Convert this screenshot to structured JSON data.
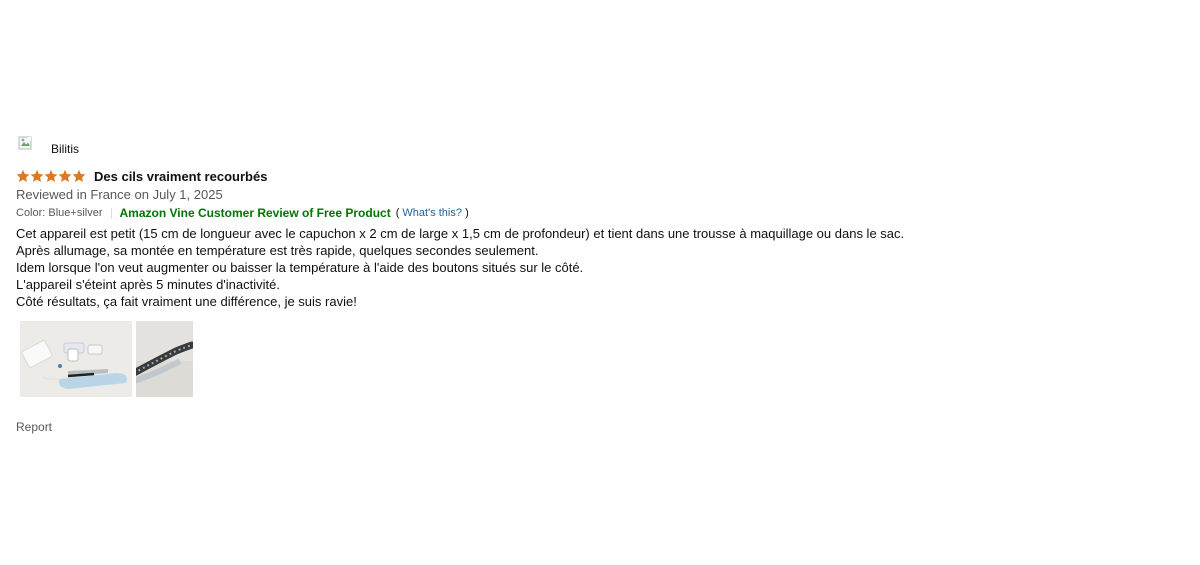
{
  "profile": {
    "name": "Bilitis",
    "avatar_icon": "broken-image-icon"
  },
  "review": {
    "rating": 5,
    "rating_max": 5,
    "star_color": "#de7921",
    "title": "Des cils vraiment recourbés",
    "date": "Reviewed in France on July 1, 2025",
    "format": "Color: Blue+silver",
    "vine_label": "Amazon Vine Customer Review of Free Product",
    "vine_color": "#007600",
    "whats_this_open": "(",
    "whats_this": "What's this?",
    "whats_this_close": ")",
    "body": [
      "Cet appareil est petit (15 cm de longueur avec le capuchon x 2 cm de large x 1,5 cm de profondeur) et tient dans une trousse à maquillage ou dans le sac.",
      "Après allumage, sa montée en température est très rapide, quelques secondes seulement.",
      "Idem lorsque l'on veut augmenter ou baisser la température à l'aide des boutons situés sur le côté.",
      "L'appareil s'éteint après 5 minutes d'inactivité.",
      "Côté résultats, ça fait vraiment une différence, je suis ravie!"
    ],
    "images": [
      "product-kit-photo",
      "eyelash-comb-closeup-photo"
    ]
  },
  "actions": {
    "report": "Report"
  }
}
